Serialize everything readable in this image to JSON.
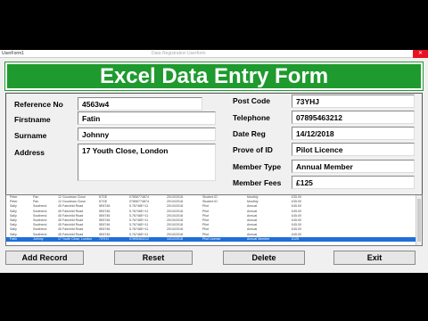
{
  "window": {
    "title": "UserForm1",
    "caption": "Data Registration Userform",
    "close": "✕"
  },
  "header": {
    "title": "Excel Data Entry Form"
  },
  "fields": {
    "reference_no": {
      "label": "Reference No",
      "value": "4563w4"
    },
    "firstname": {
      "label": "Firstname",
      "value": "Fatin"
    },
    "surname": {
      "label": "Surname",
      "value": "Johnny"
    },
    "address": {
      "label": "Address",
      "value": "17 Youth Close, London"
    },
    "post_code": {
      "label": "Post Code",
      "value": "73YHJ"
    },
    "telephone": {
      "label": "Telephone",
      "value": "07895463212"
    },
    "date_reg": {
      "label": "Date Reg",
      "value": "14/12/2018"
    },
    "prove_of_id": {
      "label": "Prove of ID",
      "value": "Pilot Licence"
    },
    "member_type": {
      "label": "Member Type",
      "value": "Annual Member"
    },
    "member_fees": {
      "label": "Member Fees",
      "value": "£125"
    }
  },
  "list": {
    "rows": [
      [
        "Peter",
        "Pan",
        "12 Goodman Close",
        "67GE",
        "07856774874",
        "20/10/2018",
        "Student ID",
        "Monthly",
        "£35.00"
      ],
      [
        "Peter",
        "Pan",
        "12 Goodman Close",
        "67GE",
        "07856774874",
        "20/10/2018",
        "Student ID",
        "Monthly",
        "£35.00"
      ],
      [
        "Sally",
        "Southend",
        "45 Fairchild Road",
        "5E6746",
        "5.76746E+11",
        "20/10/2018",
        "Pilot",
        "Annual",
        "£45.00"
      ],
      [
        "Sally",
        "Southend",
        "45 Fairchild Road",
        "5E6746",
        "5.76746E+11",
        "20/10/2018",
        "Pilot",
        "Annual",
        "£45.00"
      ],
      [
        "Sally",
        "Southend",
        "45 Fairchild Road",
        "5E6746",
        "5.76746E+11",
        "20/10/2018",
        "Pilot",
        "Annual",
        "£45.00"
      ],
      [
        "Sally",
        "Southend",
        "45 Fairchild Road",
        "5E6746",
        "5.76746E+11",
        "20/10/2018",
        "Pilot",
        "Annual",
        "£45.00"
      ],
      [
        "Sally",
        "Southend",
        "45 Fairchild Road",
        "5E6746",
        "5.76746E+11",
        "20/10/2018",
        "Pilot",
        "Annual",
        "£45.00"
      ],
      [
        "Sally",
        "Southend",
        "45 Fairchild Road",
        "5E6746",
        "5.76746E+11",
        "20/10/2018",
        "Pilot",
        "Annual",
        "£45.00"
      ],
      [
        "Sally",
        "Southend",
        "45 Fairchild Road",
        "5E6746",
        "5.76746E+11",
        "20/10/2018",
        "Pilot",
        "Annual",
        "£45.00"
      ],
      [
        "Fatin",
        "Johnny",
        "17 Youth Close, London",
        "73YHJ",
        "07895463212",
        "14/12/2018",
        "Pilot Licence",
        "Annual Member",
        "£125"
      ]
    ],
    "selected_index": 9
  },
  "buttons": {
    "add": "Add Record",
    "reset": "Reset",
    "delete": "Delete",
    "exit": "Exit"
  }
}
